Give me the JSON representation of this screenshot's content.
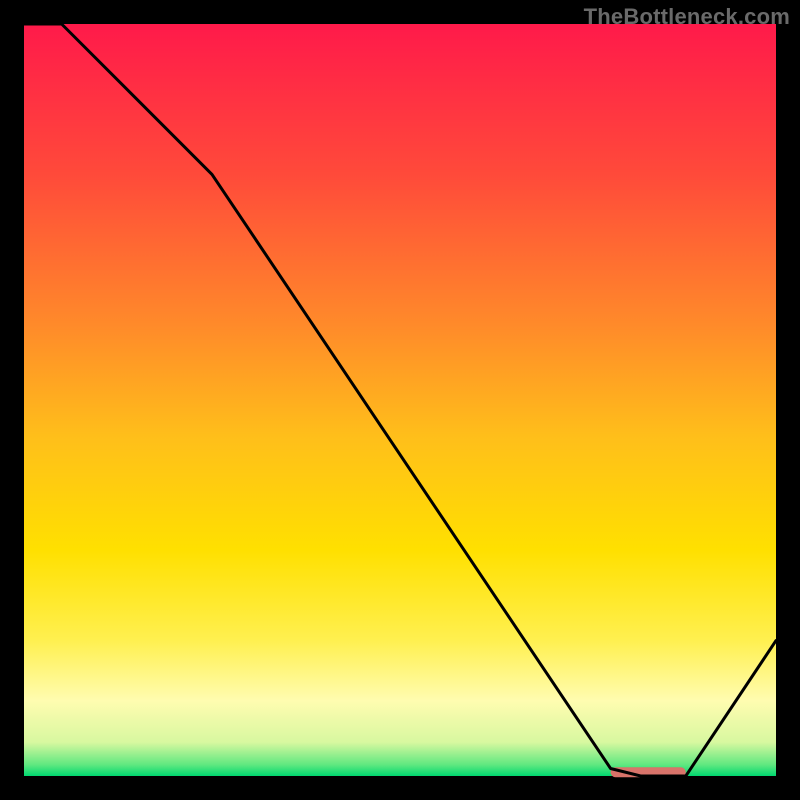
{
  "watermark": "TheBottleneck.com",
  "chart_data": {
    "type": "line",
    "title": "",
    "xlabel": "",
    "ylabel": "",
    "xlim": [
      0,
      100
    ],
    "ylim": [
      0,
      100
    ],
    "x": [
      0,
      5,
      25,
      78,
      82,
      88,
      100
    ],
    "y": [
      100,
      100,
      80,
      1,
      0,
      0,
      18
    ],
    "optimum_band": {
      "x_start": 78,
      "x_end": 88,
      "y": 0.5
    },
    "gradient_stops": [
      {
        "offset": 0.0,
        "color": "#ff1a4a"
      },
      {
        "offset": 0.2,
        "color": "#ff4a3a"
      },
      {
        "offset": 0.4,
        "color": "#ff8a2a"
      },
      {
        "offset": 0.55,
        "color": "#ffbf1a"
      },
      {
        "offset": 0.7,
        "color": "#ffe000"
      },
      {
        "offset": 0.82,
        "color": "#fff050"
      },
      {
        "offset": 0.9,
        "color": "#fffcb0"
      },
      {
        "offset": 0.955,
        "color": "#d8f8a0"
      },
      {
        "offset": 0.985,
        "color": "#60e880"
      },
      {
        "offset": 1.0,
        "color": "#00d870"
      }
    ],
    "line_color": "#000000",
    "line_width": 3,
    "marker_color": "#d8736a",
    "marker_height": 10,
    "frame_thickness": 24
  }
}
